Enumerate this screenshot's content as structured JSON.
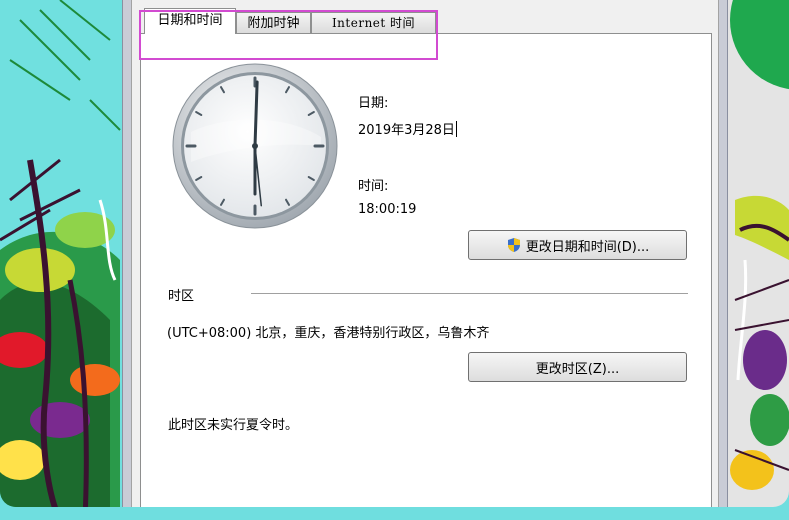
{
  "tabs": [
    {
      "label": "日期和时间",
      "active": true
    },
    {
      "label": "附加时钟",
      "active": false
    },
    {
      "label": "Internet 时间",
      "active": false
    }
  ],
  "date_section": {
    "date_label": "日期:",
    "date_value": "2019年3月28日",
    "time_label": "时间:",
    "time_value": "18:00:19"
  },
  "change_datetime_button": "更改日期和时间(D)...",
  "timezone_section": {
    "heading": "时区",
    "value": "(UTC+08:00) 北京，重庆，香港特别行政区，乌鲁木齐",
    "change_button": "更改时区(Z)...",
    "dst_note": "此时区未实行夏令时。"
  },
  "clock": {
    "hour": 18,
    "minute": 0,
    "second": 19
  },
  "colors": {
    "highlight": "#d24bd1",
    "shield_blue": "#3a6fc9",
    "shield_yellow": "#f2c21b"
  },
  "icons": [
    "uac-shield-icon",
    "analog-clock-icon"
  ]
}
